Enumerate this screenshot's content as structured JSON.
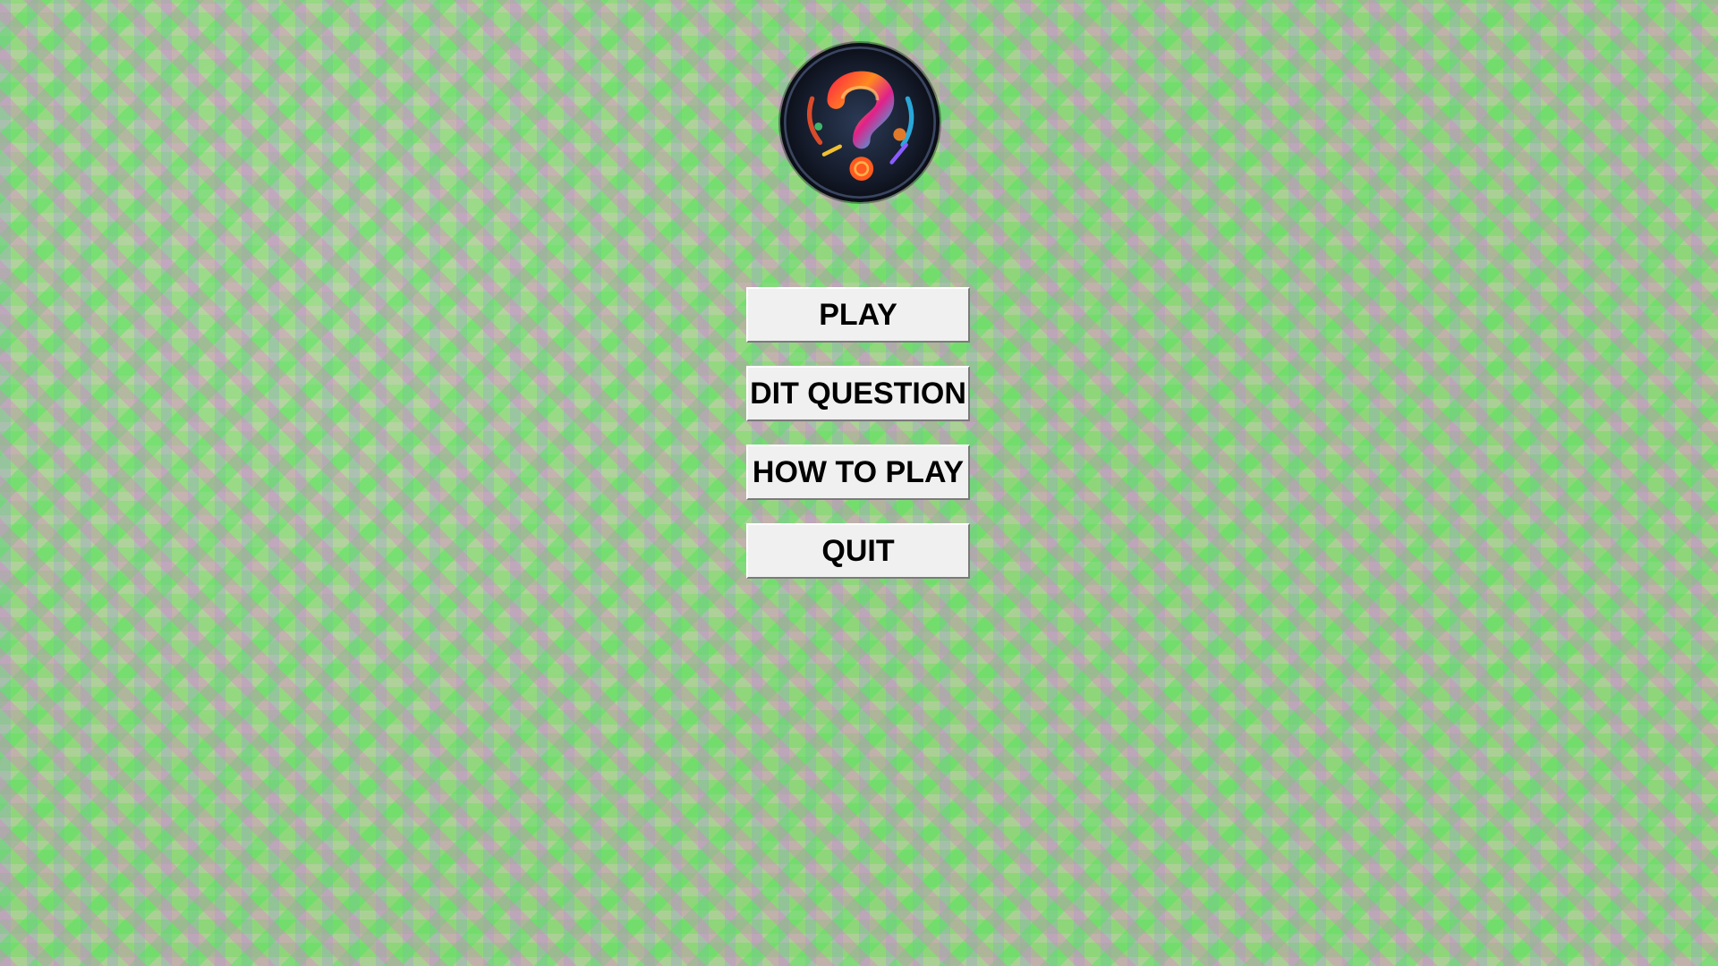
{
  "menu": {
    "play_label": "PLAY",
    "edit_question_label": "DIT QUESTION",
    "how_to_play_label": "HOW TO PLAY",
    "quit_label": "QUIT"
  },
  "logo": {
    "icon": "question-mark-logo"
  },
  "colors": {
    "button_bg": "#f0f0f0",
    "button_text": "#000000",
    "background_green": "#8fd67a",
    "background_pink": "#e678d2",
    "background_purple": "#968ceb"
  }
}
